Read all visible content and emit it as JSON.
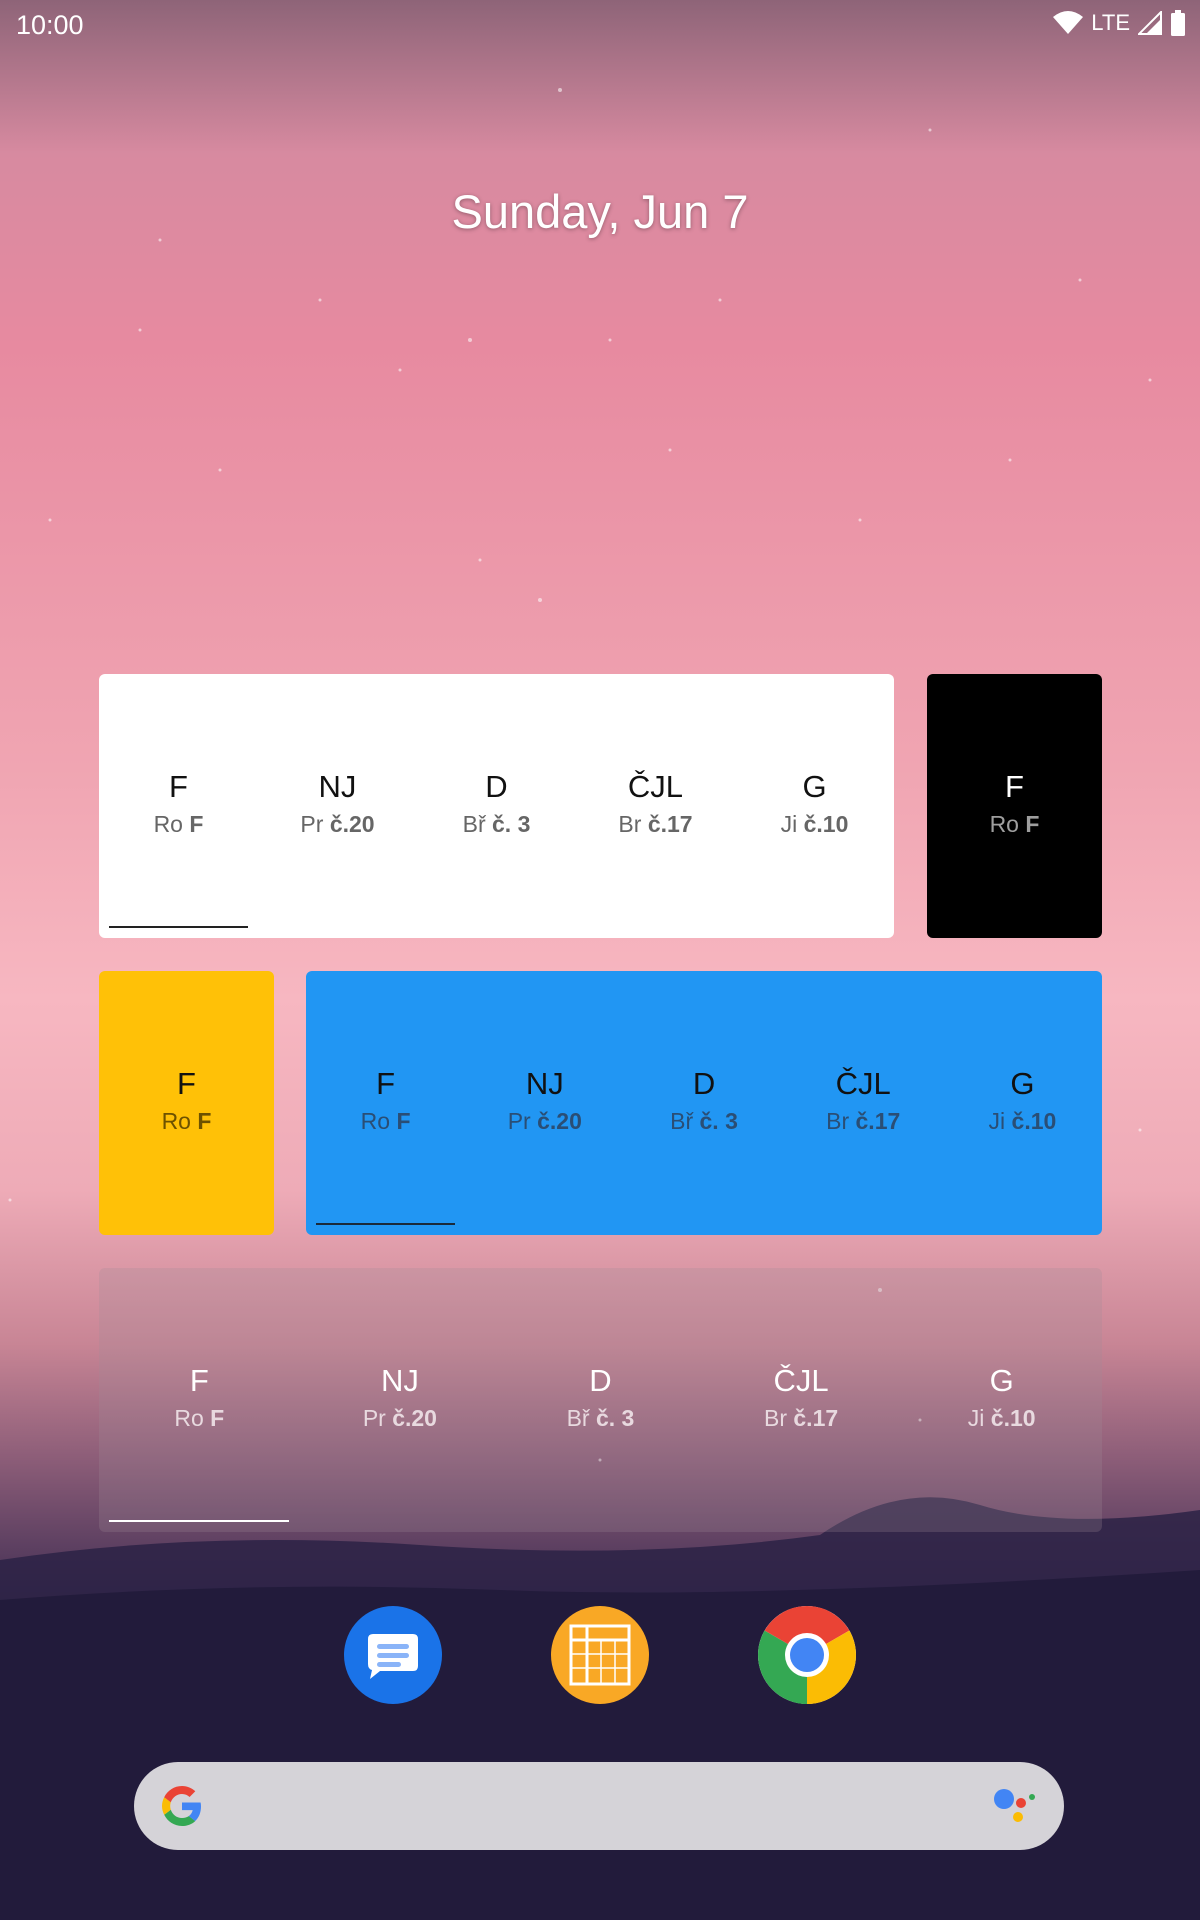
{
  "status_bar": {
    "time": "10:00",
    "network": "LTE"
  },
  "date": "Sunday, Jun 7",
  "widgets": {
    "white": {
      "bg": "#ffffff",
      "items": [
        {
          "subject": "F",
          "teacher": "Ro",
          "room": "F"
        },
        {
          "subject": "NJ",
          "teacher": "Pr",
          "room": "č.20"
        },
        {
          "subject": "D",
          "teacher": "Bř",
          "room": "č. 3"
        },
        {
          "subject": "ČJL",
          "teacher": "Br",
          "room": "č.17"
        },
        {
          "subject": "G",
          "teacher": "Ji",
          "room": "č.10"
        }
      ]
    },
    "black": {
      "bg": "#000000",
      "items": [
        {
          "subject": "F",
          "teacher": "Ro",
          "room": "F"
        }
      ]
    },
    "yellow": {
      "bg": "#ffc107",
      "items": [
        {
          "subject": "F",
          "teacher": "Ro",
          "room": "F"
        }
      ]
    },
    "blue": {
      "bg": "#2196f3",
      "items": [
        {
          "subject": "F",
          "teacher": "Ro",
          "room": "F"
        },
        {
          "subject": "NJ",
          "teacher": "Pr",
          "room": "č.20"
        },
        {
          "subject": "D",
          "teacher": "Bř",
          "room": "č. 3"
        },
        {
          "subject": "ČJL",
          "teacher": "Br",
          "room": "č.17"
        },
        {
          "subject": "G",
          "teacher": "Ji",
          "room": "č.10"
        }
      ]
    },
    "transparent": {
      "items": [
        {
          "subject": "F",
          "teacher": "Ro",
          "room": "F"
        },
        {
          "subject": "NJ",
          "teacher": "Pr",
          "room": "č.20"
        },
        {
          "subject": "D",
          "teacher": "Bř",
          "room": "č. 3"
        },
        {
          "subject": "ČJL",
          "teacher": "Br",
          "room": "č.17"
        },
        {
          "subject": "G",
          "teacher": "Ji",
          "room": "č.10"
        }
      ]
    }
  },
  "dock": [
    {
      "name": "messages-app-icon",
      "color": "#1a73e8"
    },
    {
      "name": "timetable-app-icon",
      "color": "#f9a825"
    },
    {
      "name": "chrome-app-icon",
      "color": "#ea4335"
    }
  ],
  "search_bar": {
    "logo": "google-g-icon",
    "assistant": "assistant-dots-icon"
  }
}
